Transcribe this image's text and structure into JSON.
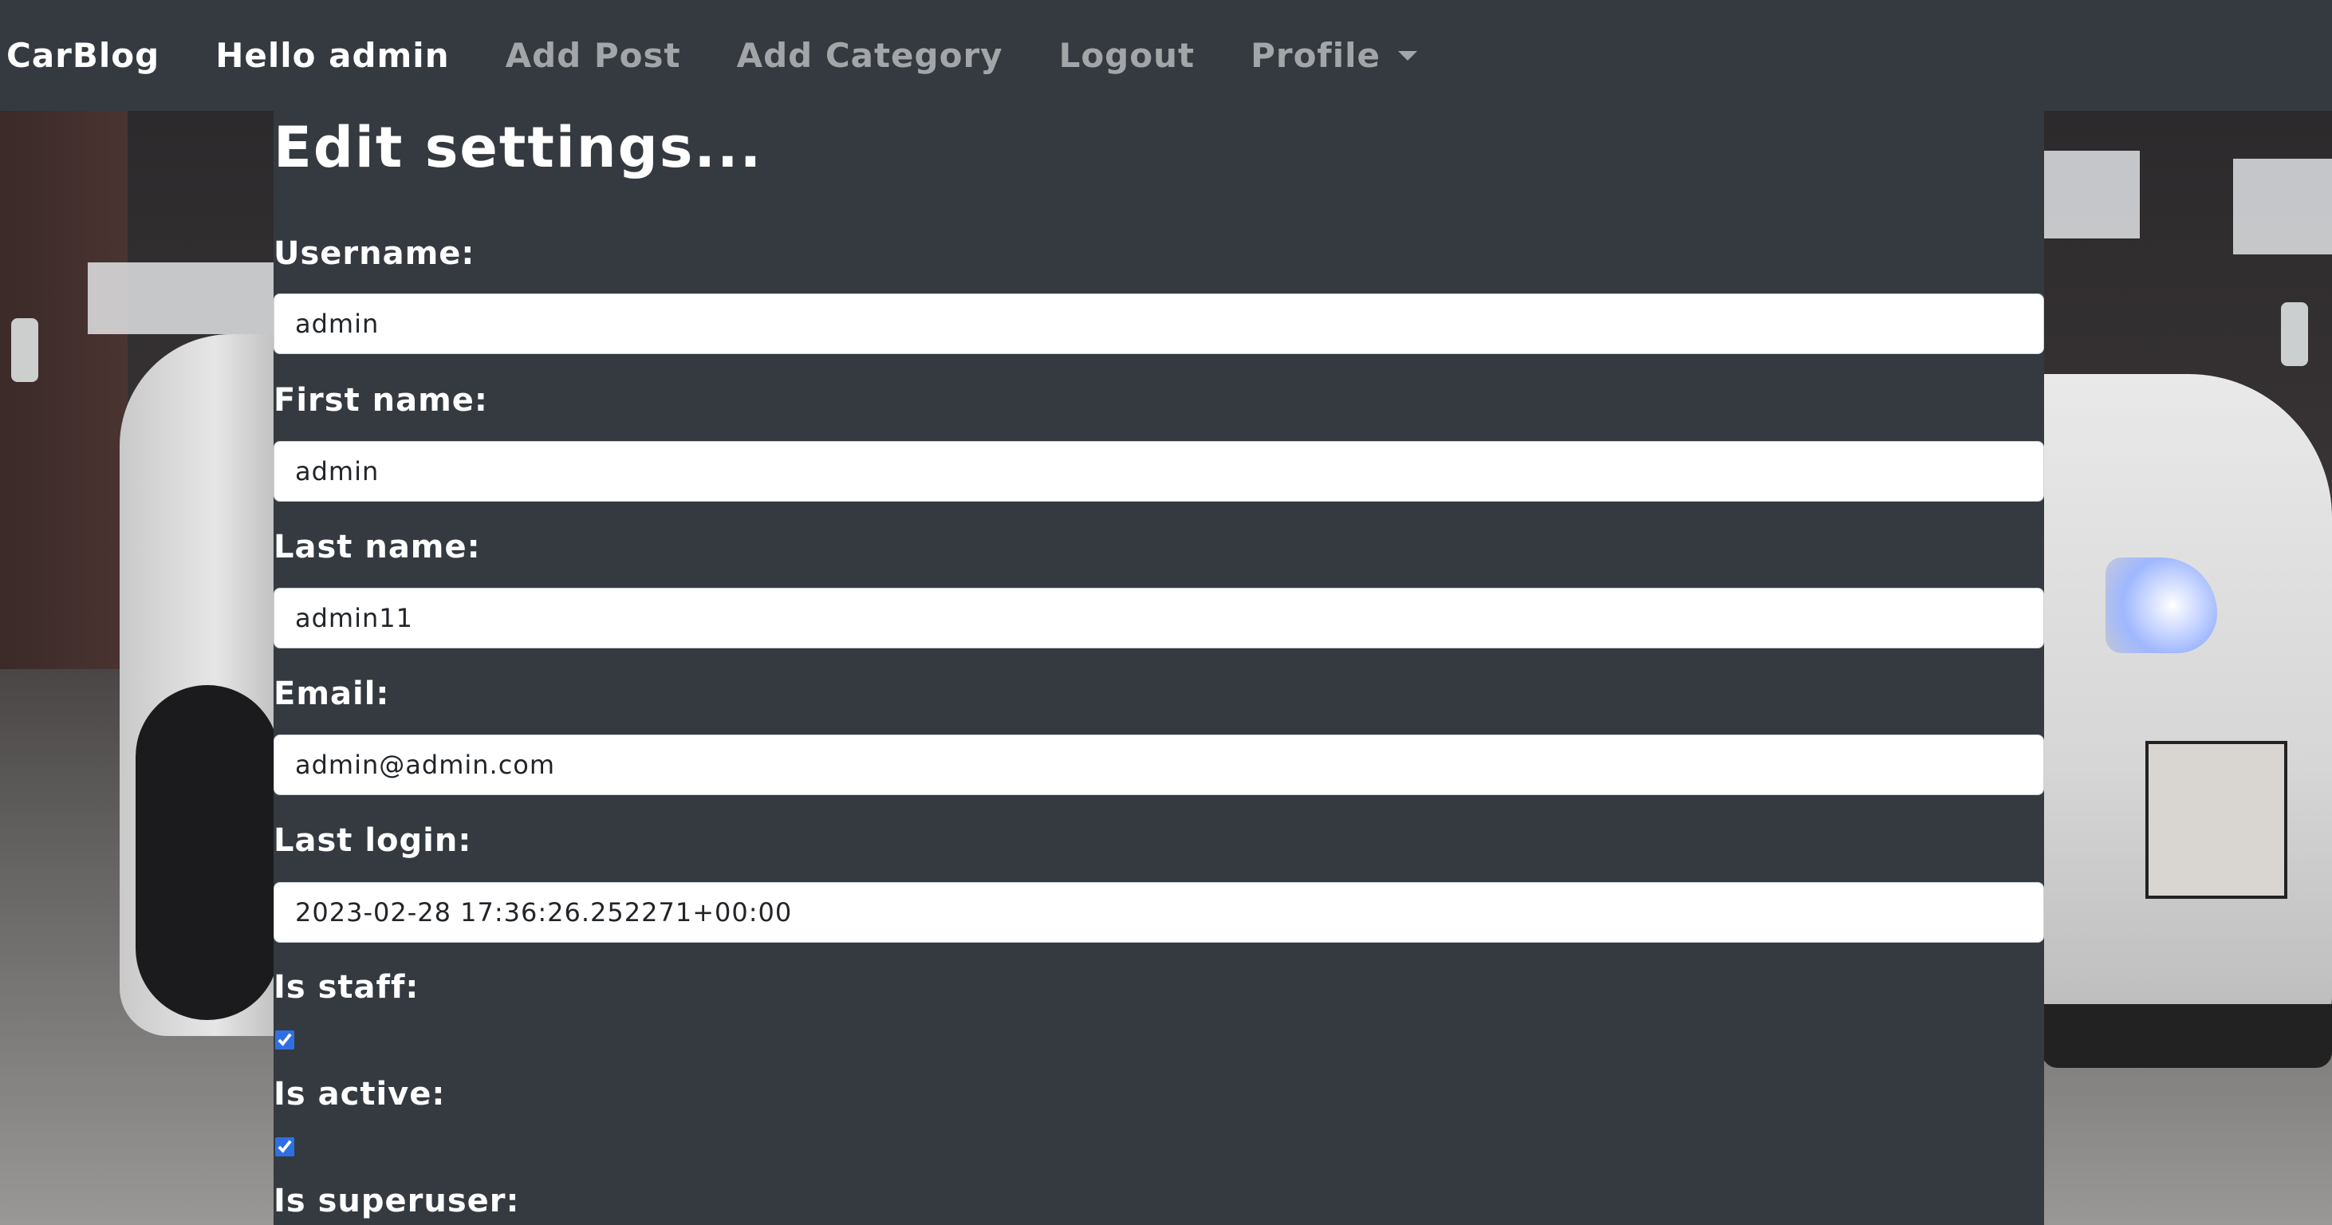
{
  "navbar": {
    "brand": "CarBlog",
    "items": [
      {
        "label": "Hello admin"
      },
      {
        "label": "Add Post"
      },
      {
        "label": "Add Category"
      },
      {
        "label": "Logout"
      },
      {
        "label": "Profile"
      }
    ]
  },
  "form": {
    "title": "Edit settings...",
    "username": {
      "label": "Username:",
      "value": "admin"
    },
    "first_name": {
      "label": "First name:",
      "value": "admin"
    },
    "last_name": {
      "label": "Last name:",
      "value": "admin11"
    },
    "email": {
      "label": "Email:",
      "value": "admin@admin.com"
    },
    "last_login": {
      "label": "Last login:",
      "value": "2023-02-28 17:36:26.252271+00:00"
    },
    "is_staff": {
      "label": "Is staff:",
      "checked": true
    },
    "is_active": {
      "label": "Is active:",
      "checked": true
    },
    "is_superuser": {
      "label": "Is superuser:"
    }
  },
  "colors": {
    "navbar_bg": "#343a40",
    "panel_bg": "#343a40",
    "checkbox_accent": "#2f6fe4"
  },
  "icons": {
    "profile_dropdown": "caret-down-icon"
  }
}
